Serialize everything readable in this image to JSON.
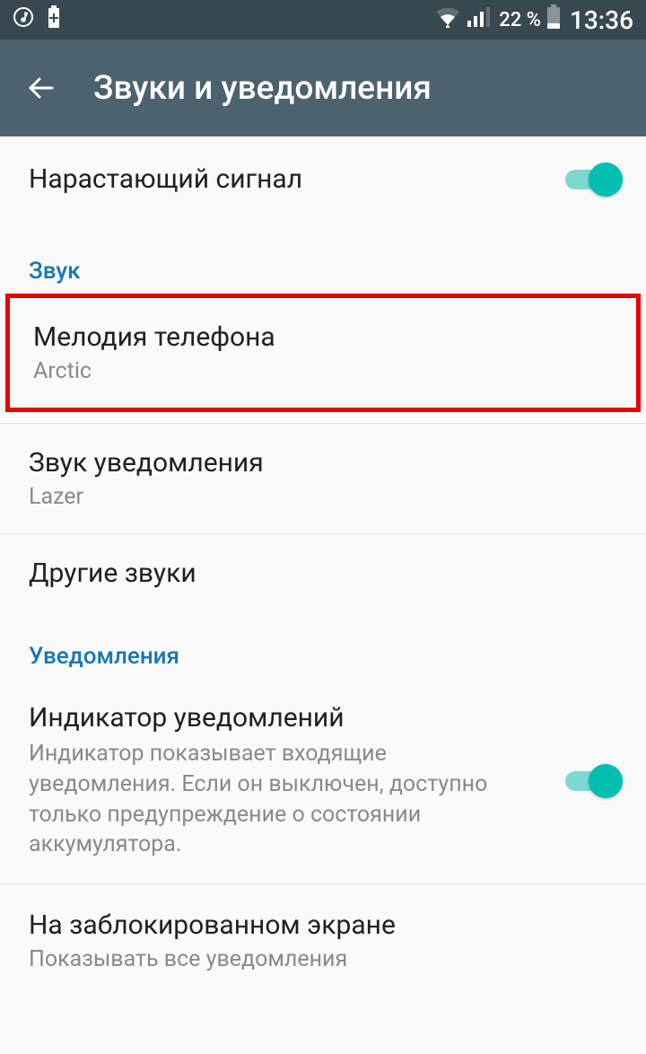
{
  "statusbar": {
    "battery_percent": "22 %",
    "time": "13:36"
  },
  "appbar": {
    "title": "Звуки и уведомления"
  },
  "settings": {
    "ascending_signal": {
      "label": "Нарастающий сигнал",
      "enabled": true
    },
    "sections": {
      "sound": "Звук",
      "notifications": "Уведомления"
    },
    "ringtone": {
      "label": "Мелодия телефона",
      "value": "Arctic"
    },
    "notification_sound": {
      "label": "Звук уведомления",
      "value": "Lazer"
    },
    "other_sounds": {
      "label": "Другие звуки"
    },
    "notification_indicator": {
      "label": "Индикатор уведомлений",
      "description": "Индикатор показывает входящие уведомления. Если он выключен, доступно только предупреждение о состоянии аккумулятора.",
      "enabled": true
    },
    "on_lock_screen": {
      "label": "На заблокированном экране",
      "value": "Показывать все уведомления"
    }
  }
}
